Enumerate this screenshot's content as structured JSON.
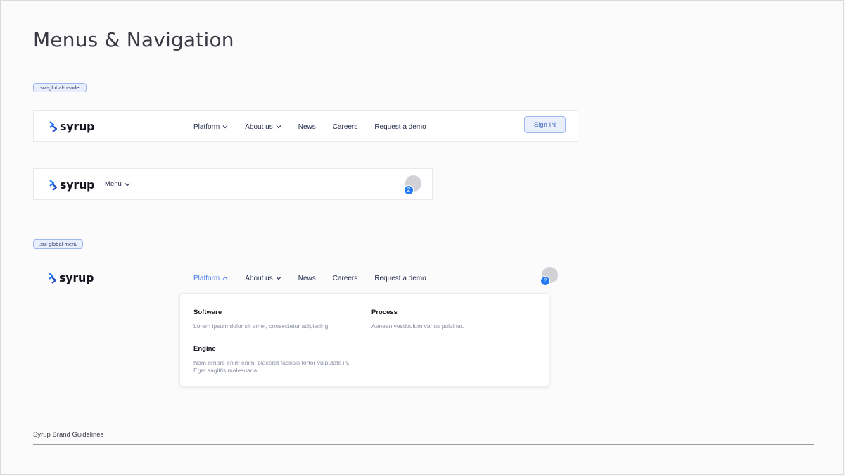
{
  "page": {
    "title": "Menus & Navigation"
  },
  "tags": {
    "header": ".sui-global-header",
    "menu": ".sui-global-menu"
  },
  "brand": {
    "logo_text": "syrup",
    "logo_icon": "syrup-logo-icon",
    "accent": "#2479f2",
    "active_color": "#4a7ee6"
  },
  "nav": {
    "items": [
      {
        "label": "Platform",
        "has_dropdown": true
      },
      {
        "label": "About us",
        "has_dropdown": true
      },
      {
        "label": "News",
        "has_dropdown": false
      },
      {
        "label": "Careers",
        "has_dropdown": false
      },
      {
        "label": "Request a demo",
        "has_dropdown": false
      }
    ]
  },
  "header": {
    "signin_label": "Sign IN"
  },
  "mobile": {
    "menu_label": "Menu"
  },
  "notifications": {
    "count": "2"
  },
  "dropdown": {
    "items": [
      {
        "title": "Software",
        "description": "Lorem ipsum dolor sit amet, consectetur adipiscing!"
      },
      {
        "title": "Process",
        "description": "Aenean vestibulum varius pulvinar."
      },
      {
        "title": "Engine",
        "description": "Nam ornare enim enim, placerat facilisis tortor vulputate in. Eget sagittis malesuada."
      }
    ]
  },
  "footer": {
    "text": "Syrup Brand Guidelines"
  }
}
